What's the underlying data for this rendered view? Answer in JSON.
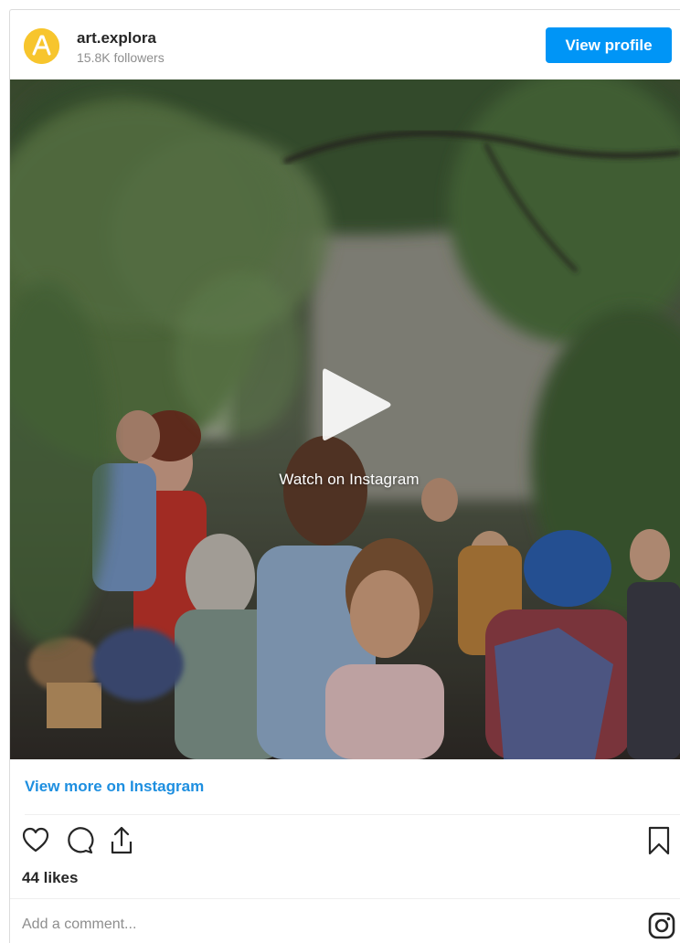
{
  "header": {
    "username": "art.explora",
    "followers": "15.8K followers",
    "view_profile_label": "View profile"
  },
  "media": {
    "watch_label": "Watch on Instagram"
  },
  "footer": {
    "view_more_label": "View more on Instagram",
    "likes": "44 likes",
    "comment_placeholder": "Add a comment..."
  },
  "colors": {
    "accent": "#0095f6",
    "link": "#1e8fe0",
    "avatar": "#f7c52d"
  },
  "icons": [
    "heart-icon",
    "comment-icon",
    "share-icon",
    "bookmark-icon",
    "instagram-icon",
    "play-icon"
  ]
}
